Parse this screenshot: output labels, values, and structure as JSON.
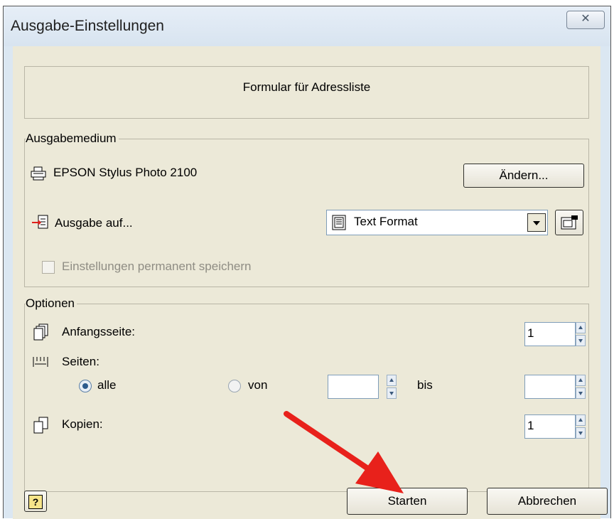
{
  "window": {
    "title": "Ausgabe-Einstellungen",
    "close_icon": "close-icon"
  },
  "header": {
    "text": "Formular für Adressliste"
  },
  "ausgabemedium": {
    "legend": "Ausgabemedium",
    "printer_name": "EPSON Stylus Photo 2100",
    "change_button": "Ändern...",
    "output_label": "Ausgabe auf...",
    "format_value": "Text Format",
    "save_permanent_label": "Einstellungen permanent speichern"
  },
  "optionen": {
    "legend": "Optionen",
    "start_page_label": "Anfangsseite:",
    "start_page_value": "1",
    "pages_label": "Seiten:",
    "all_label": "alle",
    "from_label": "von",
    "from_value": "",
    "to_label": "bis",
    "to_value": "",
    "copies_label": "Kopien:",
    "copies_value": "1",
    "pages_mode": "alle"
  },
  "footer": {
    "help_label": "?",
    "start_button": "Starten",
    "cancel_button": "Abbrechen"
  },
  "colors": {
    "annotation_arrow": "#e8211b",
    "title_bar": "#dbe7f2",
    "dialog_face": "#ece9d8"
  }
}
